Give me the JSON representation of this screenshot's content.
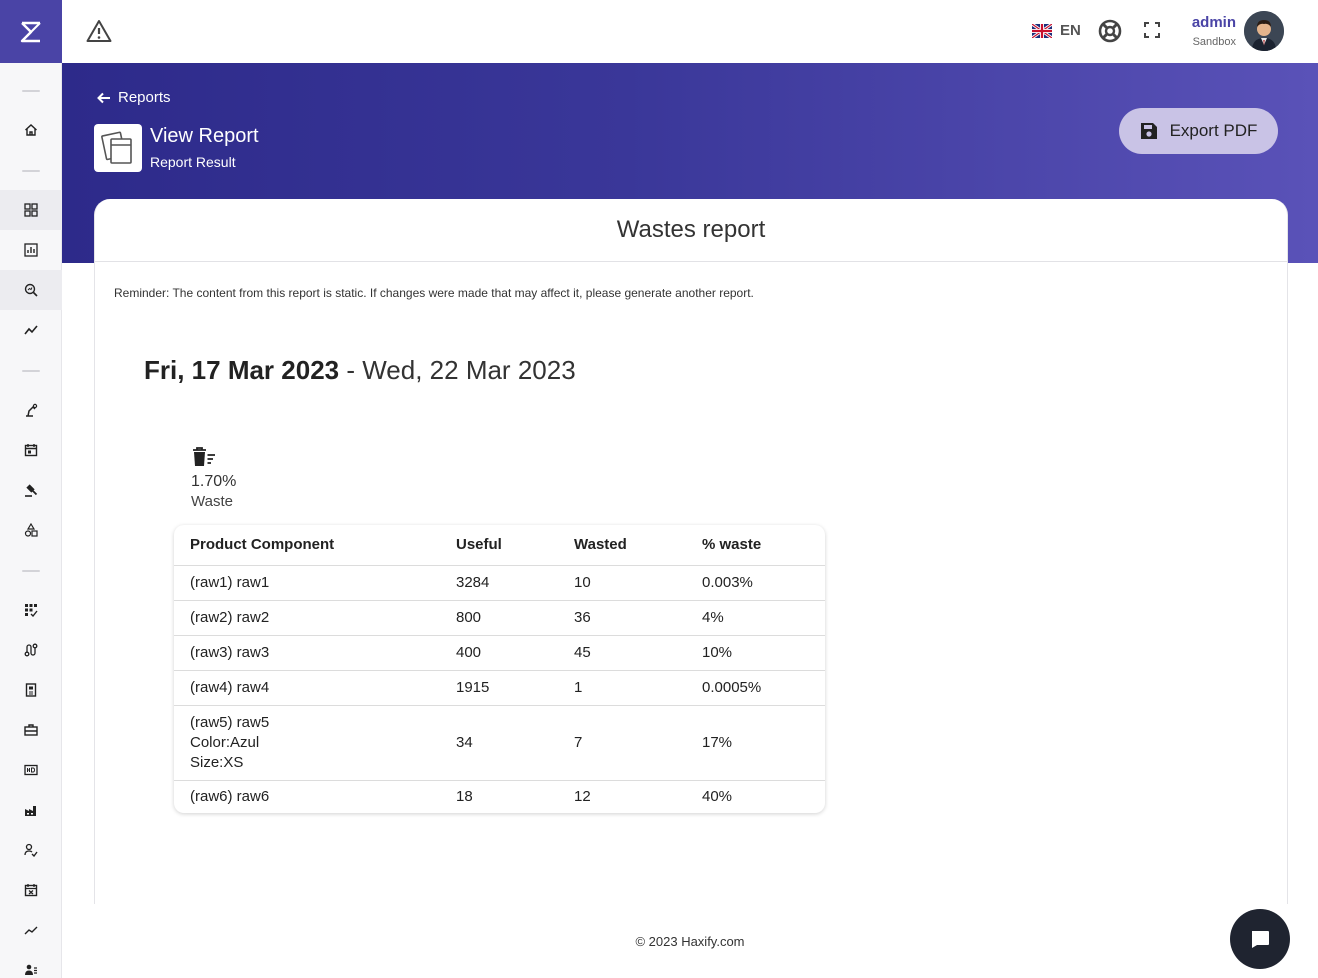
{
  "sidebar": {
    "logo_icon": "haxify-logo",
    "items": [
      {
        "icon": "home-icon"
      },
      {
        "icon": "dashboard-icon"
      },
      {
        "icon": "bar-chart-icon"
      },
      {
        "icon": "search-report-icon"
      },
      {
        "icon": "trend-icon"
      },
      {
        "icon": "robot-arm-icon"
      },
      {
        "icon": "calendar-icon"
      },
      {
        "icon": "gavel-icon"
      },
      {
        "icon": "shapes-icon"
      },
      {
        "icon": "grid-check-icon"
      },
      {
        "icon": "route-icon"
      },
      {
        "icon": "document-icon"
      },
      {
        "icon": "toolbox-icon"
      },
      {
        "icon": "hd-icon"
      },
      {
        "icon": "factory-icon"
      },
      {
        "icon": "person-check-icon"
      },
      {
        "icon": "calendar-x-icon"
      },
      {
        "icon": "trending-icon"
      },
      {
        "icon": "people-icon"
      }
    ]
  },
  "topbar": {
    "warning_icon": "warning-icon",
    "language": "EN",
    "user_name": "admin",
    "user_org": "Sandbox"
  },
  "header": {
    "back_label": "Reports",
    "title": "View Report",
    "subtitle": "Report Result",
    "export_label": "Export PDF"
  },
  "report": {
    "title": "Wastes report",
    "reminder": "Reminder: The content from this report is static. If changes were made that may affect it, please generate another report.",
    "date_start": "Fri, 17 Mar 2023",
    "date_sep": " - ",
    "date_end": "Wed, 22 Mar 2023",
    "waste_pct": "1.70%",
    "waste_label": "Waste",
    "columns": [
      "Product Component",
      "Useful",
      "Wasted",
      "% waste"
    ],
    "rows": [
      {
        "component": [
          "(raw1) raw1"
        ],
        "useful": "3284",
        "wasted": "10",
        "pct": "0.003%"
      },
      {
        "component": [
          "(raw2) raw2"
        ],
        "useful": "800",
        "wasted": "36",
        "pct": "4%"
      },
      {
        "component": [
          "(raw3) raw3"
        ],
        "useful": "400",
        "wasted": "45",
        "pct": "10%"
      },
      {
        "component": [
          "(raw4) raw4"
        ],
        "useful": "1915",
        "wasted": "1",
        "pct": "0.0005%"
      },
      {
        "component": [
          "(raw5) raw5",
          "Color:Azul",
          "Size:XS"
        ],
        "useful": "34",
        "wasted": "7",
        "pct": "17%"
      },
      {
        "component": [
          "(raw6) raw6"
        ],
        "useful": "18",
        "wasted": "12",
        "pct": "40%"
      }
    ]
  },
  "footer": {
    "copyright": "© 2023 Haxify.com"
  },
  "colors": {
    "brand": "#4a44a6",
    "header_gradient_start": "#2d2a8a",
    "header_gradient_end": "#5a52b8",
    "export_button": "#c9c3e6",
    "chat_button": "#1f2430"
  }
}
